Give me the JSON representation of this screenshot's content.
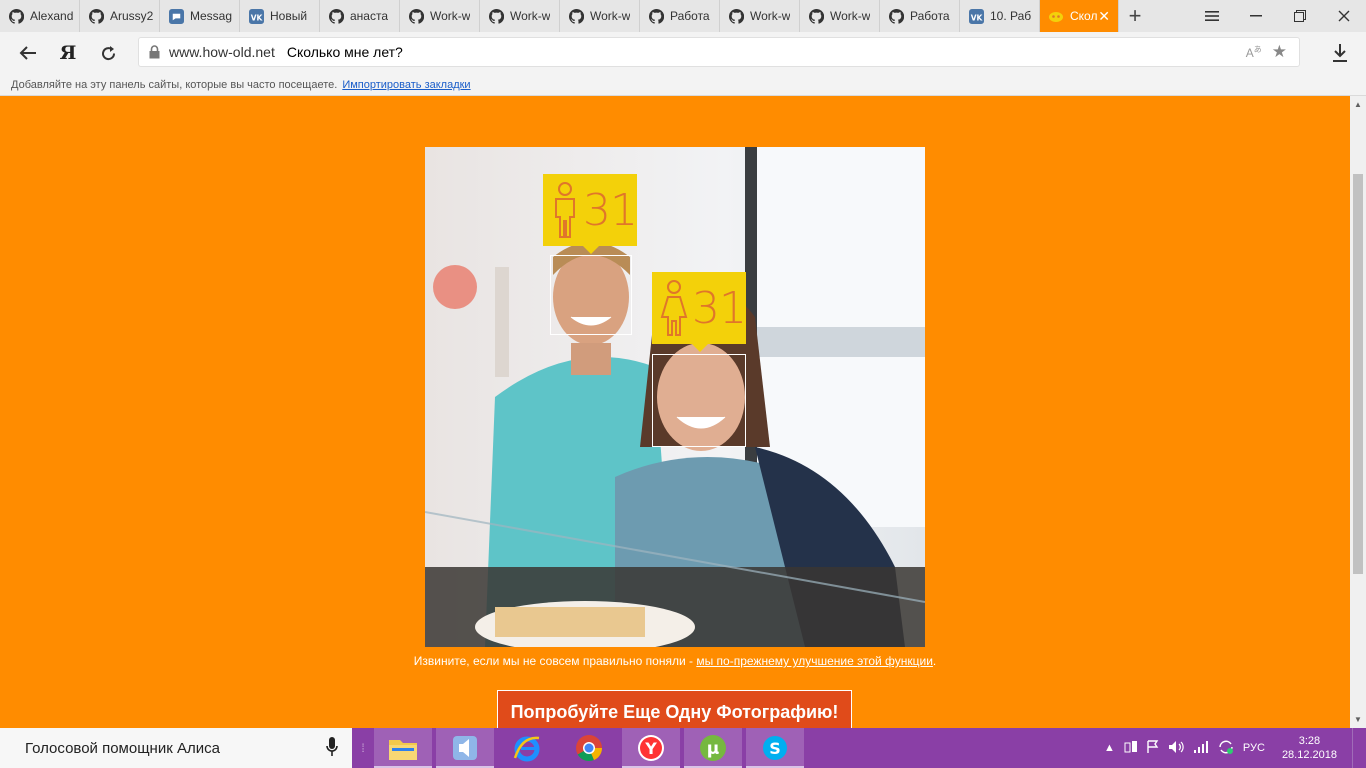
{
  "browser": {
    "tabs": [
      {
        "label": "Alexand",
        "icon": "github-icon"
      },
      {
        "label": "Arussy2",
        "icon": "github-icon"
      },
      {
        "label": "Messag",
        "icon": "messages-icon"
      },
      {
        "label": "Новый",
        "icon": "vk-icon"
      },
      {
        "label": "анаста",
        "icon": "github-icon"
      },
      {
        "label": "Work-w",
        "icon": "github-icon"
      },
      {
        "label": "Work-w",
        "icon": "github-icon"
      },
      {
        "label": "Work-w",
        "icon": "github-icon"
      },
      {
        "label": "Работа",
        "icon": "github-icon"
      },
      {
        "label": "Work-w",
        "icon": "github-icon"
      },
      {
        "label": "Work-w",
        "icon": "github-icon"
      },
      {
        "label": "Работа",
        "icon": "github-icon"
      },
      {
        "label": "10. Раб",
        "icon": "vk-icon"
      },
      {
        "label": "Скол",
        "icon": "how-old-icon",
        "active": true
      }
    ],
    "address": {
      "host": "www.how-old.net",
      "page_title": "Сколько мне лет?"
    },
    "bookmarks_bar": {
      "hint": "Добавляйте на эту панель сайты, которые вы часто посещаете.",
      "import_link": "Импортировать закладки"
    }
  },
  "page": {
    "faces": [
      {
        "age": "31",
        "icon": "male-person-icon"
      },
      {
        "age": "31",
        "icon": "female-person-icon"
      }
    ],
    "caption_text": "Извините, если мы не совсем правильно поняли - ",
    "caption_link": "мы по-прежнему улучшение этой функции",
    "caption_end": ".",
    "try_button": "Попробуйте Еще Одну Фотографию!"
  },
  "taskbar": {
    "search_text": "Голосовой помощник Алиса",
    "apps": [
      "file-explorer-icon",
      "media-player-icon",
      "internet-explorer-icon",
      "chrome-icon",
      "yandex-browser-icon",
      "utorrent-icon",
      "skype-icon"
    ],
    "language": "РУС",
    "time": "3:28",
    "date": "28.12.2018"
  },
  "colors": {
    "page_background": "#ff8c00",
    "badge_yellow": "#f3d10a",
    "button_red": "#e04b1a",
    "taskbar_purple": "#8a3fa6"
  }
}
